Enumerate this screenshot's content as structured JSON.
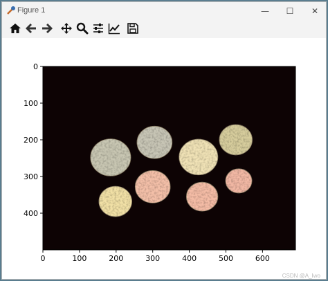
{
  "window": {
    "title": "Figure 1",
    "controls": {
      "minimize": "—",
      "maximize": "☐",
      "close": "✕"
    }
  },
  "toolbar": {
    "buttons": [
      {
        "name": "home",
        "icon": "home-icon"
      },
      {
        "name": "back",
        "icon": "arrow-left-icon"
      },
      {
        "name": "forward",
        "icon": "arrow-right-icon"
      },
      {
        "name": "pan",
        "icon": "move-icon"
      },
      {
        "name": "zoom",
        "icon": "magnifier-icon"
      },
      {
        "name": "configure-subplots",
        "icon": "sliders-icon"
      },
      {
        "name": "edit-axis",
        "icon": "line-chart-icon"
      },
      {
        "name": "save",
        "icon": "floppy-disk-icon"
      }
    ]
  },
  "plot": {
    "x_ticks": [
      "0",
      "100",
      "200",
      "300",
      "400",
      "500",
      "600"
    ],
    "y_ticks": [
      "0",
      "100",
      "200",
      "300",
      "400"
    ],
    "image_background": "#0d0304"
  },
  "chart_data": {
    "type": "image",
    "xlim": [
      0,
      690
    ],
    "ylim": [
      500,
      0
    ],
    "x_ticks": [
      0,
      100,
      200,
      300,
      400,
      500,
      600
    ],
    "y_ticks": [
      0,
      100,
      200,
      300,
      400
    ],
    "coins": [
      {
        "cx": 185,
        "cy": 248,
        "r": 55,
        "color": "#c8c6b2"
      },
      {
        "cx": 305,
        "cy": 207,
        "r": 48,
        "color": "#c7c5b5"
      },
      {
        "cx": 425,
        "cy": 247,
        "r": 53,
        "color": "#f0e2b6"
      },
      {
        "cx": 527,
        "cy": 200,
        "r": 45,
        "color": "#d6cc9c"
      },
      {
        "cx": 300,
        "cy": 328,
        "r": 48,
        "color": "#f3bfa8"
      },
      {
        "cx": 435,
        "cy": 355,
        "r": 43,
        "color": "#f4bca6"
      },
      {
        "cx": 535,
        "cy": 312,
        "r": 36,
        "color": "#f2b8a4"
      },
      {
        "cx": 198,
        "cy": 368,
        "r": 45,
        "color": "#f1e0a6"
      }
    ]
  },
  "watermark": "CSDN @A_Iwo"
}
